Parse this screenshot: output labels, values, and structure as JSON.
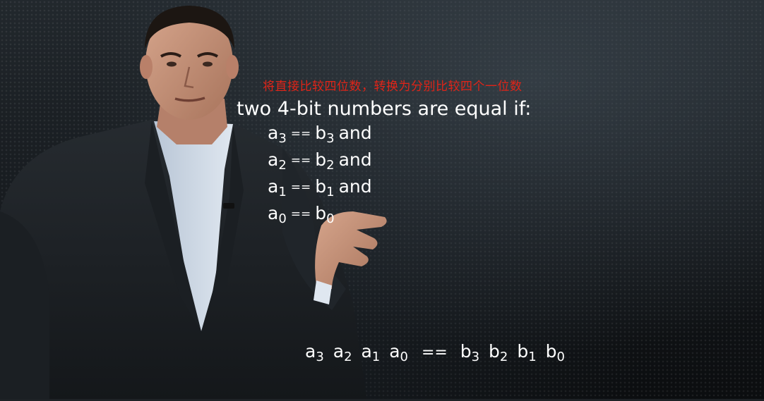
{
  "overlay_text": "将直接比较四位数，转换为分别比较四个一位数",
  "slide": {
    "heading": "two 4-bit numbers are equal if:",
    "conditions": [
      {
        "a": "a",
        "a_sub": "3",
        "op": "==",
        "b": "b",
        "b_sub": "3",
        "conj": "and"
      },
      {
        "a": "a",
        "a_sub": "2",
        "op": "==",
        "b": "b",
        "b_sub": "2",
        "conj": "and"
      },
      {
        "a": "a",
        "a_sub": "1",
        "op": "==",
        "b": "b",
        "b_sub": "1",
        "conj": "and"
      },
      {
        "a": "a",
        "a_sub": "0",
        "op": "==",
        "b": "b",
        "b_sub": "0",
        "conj": ""
      }
    ],
    "formula": {
      "left": [
        {
          "v": "a",
          "s": "3"
        },
        {
          "v": "a",
          "s": "2"
        },
        {
          "v": "a",
          "s": "1"
        },
        {
          "v": "a",
          "s": "0"
        }
      ],
      "op": "==",
      "right": [
        {
          "v": "b",
          "s": "3"
        },
        {
          "v": "b",
          "s": "2"
        },
        {
          "v": "b",
          "s": "1"
        },
        {
          "v": "b",
          "s": "0"
        }
      ]
    }
  },
  "video": {
    "progress": 0.0,
    "progress_color": "#2d8bd8",
    "subtitle_color": "#e02418"
  }
}
